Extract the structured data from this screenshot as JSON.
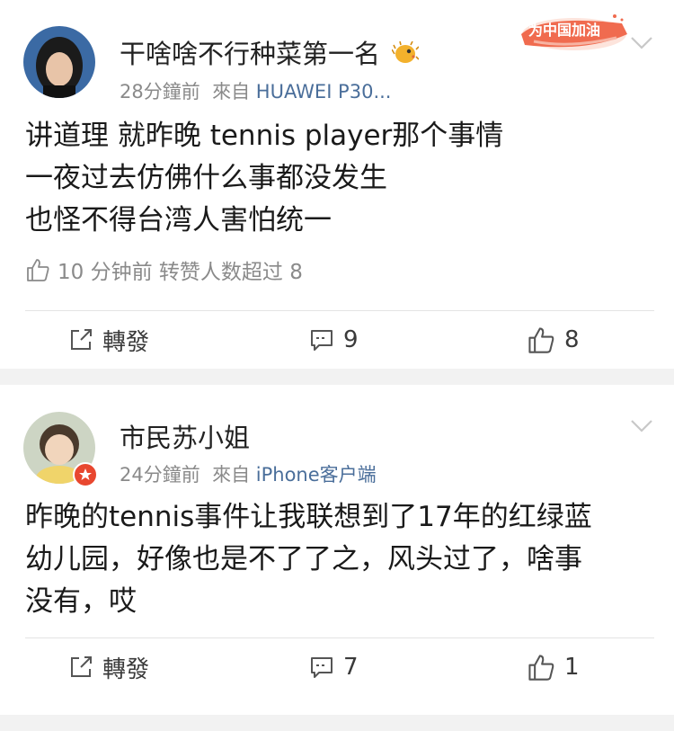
{
  "posts": [
    {
      "username": "干啥啥不行种菜第一名",
      "time": "28分鐘前",
      "from_label": "來自",
      "source": "HUAWEI P30...",
      "body_lines": [
        "讲道理 就昨晚 tennis player那个事情",
        "一夜过去仿佛什么事都没发生",
        "也怪不得台湾人害怕统一"
      ],
      "like_line": "10 分钟前 转赞人数超过 8",
      "actions": {
        "repost": "轉發",
        "comments": "9",
        "likes": "8"
      },
      "badge": "为中国加油"
    },
    {
      "username": "市民苏小姐",
      "time": "24分鐘前",
      "from_label": "來自",
      "source": "iPhone客户端",
      "body_lines": [
        "昨晚的tennis事件让我联想到了17年的红绿蓝",
        "幼儿园，好像也是不了了之，风头过了，啥事",
        "没有，哎"
      ],
      "actions": {
        "repost": "轉發",
        "comments": "7",
        "likes": "1"
      }
    }
  ],
  "icons": {
    "like": "thumbs-up-icon",
    "repost": "share-icon",
    "comment": "comment-icon",
    "more": "chevron-down-icon",
    "pufferfish": "pufferfish-icon"
  },
  "colors": {
    "source_link": "#4a6e9a",
    "promo_red": "#e8472f",
    "gap": "#f2f2f2"
  }
}
